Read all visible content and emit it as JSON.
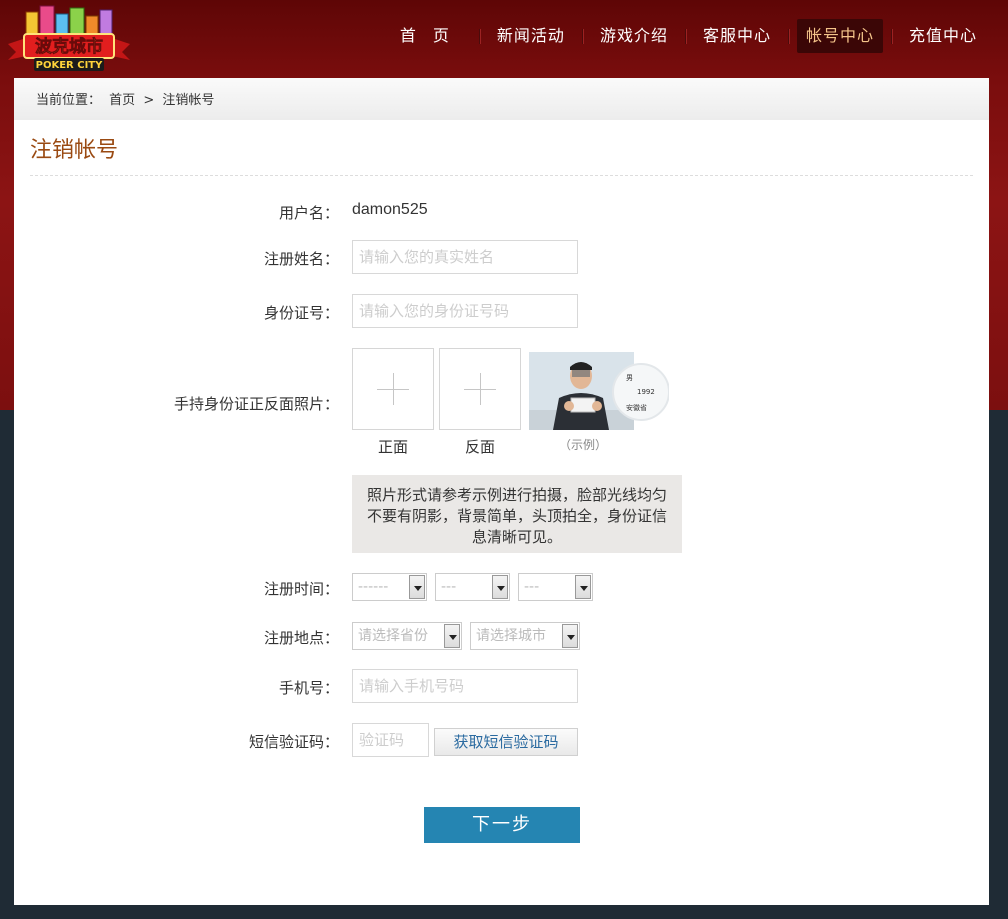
{
  "header": {
    "logo": {
      "top_text": "波克城市",
      "bottom_text": "POKER CITY"
    },
    "nav": [
      {
        "label": "首 页",
        "active": false
      },
      {
        "label": "新闻活动",
        "active": false
      },
      {
        "label": "游戏介绍",
        "active": false
      },
      {
        "label": "客服中心",
        "active": false
      },
      {
        "label": "帐号中心",
        "active": true
      },
      {
        "label": "充值中心",
        "active": false
      }
    ]
  },
  "breadcrumb": {
    "prefix": "当前位置：",
    "home": "首页",
    "separator": ">",
    "current": "注销帐号"
  },
  "page": {
    "title": "注销帐号"
  },
  "form": {
    "username": {
      "label": "用户名：",
      "value": "damon525"
    },
    "real_name": {
      "label": "注册姓名：",
      "placeholder": "请输入您的真实姓名"
    },
    "id_number": {
      "label": "身份证号：",
      "placeholder": "请输入您的身份证号码"
    },
    "id_photos": {
      "label": "手持身份证正反面照片：",
      "front_caption": "正面",
      "back_caption": "反面",
      "example_caption": "（示例）",
      "example_card_text": [
        "男",
        "1992",
        "安徽省"
      ]
    },
    "notice": "照片形式请参考示例进行拍摄，脸部光线均匀不要有阴影，背景简单，头顶拍全，身份证信息清晰可见。",
    "reg_time": {
      "label": "注册时间：",
      "year": "------",
      "month": "---",
      "day": "---"
    },
    "reg_place": {
      "label": "注册地点：",
      "province": "请选择省份",
      "city": "请选择城市"
    },
    "phone": {
      "label": "手机号：",
      "placeholder": "请输入手机号码"
    },
    "sms": {
      "label": "短信验证码：",
      "placeholder": "验证码",
      "button": "获取短信验证码"
    },
    "next_button": "下一步"
  },
  "colors": {
    "header_red": "#7a0d0d",
    "dark_bg": "#1f2b35",
    "title_brown": "#9a4a12",
    "button_blue": "#2585b2"
  }
}
